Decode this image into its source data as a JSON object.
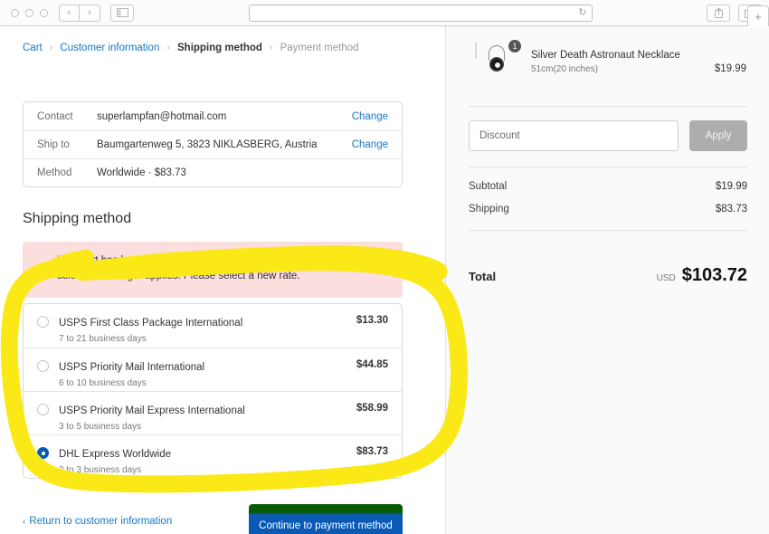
{
  "browser": {
    "traffic_lights": [
      "close-light",
      "minimize-light",
      "maximize-light"
    ],
    "back_glyph": "‹",
    "forward_glyph": "›",
    "sidebar_icon": "sidebar-toggle-icon",
    "url_value": "",
    "reload_glyph": "↻",
    "share_icon": "share-icon",
    "tabs_icon": "tab-overview-icon",
    "newtab_glyph": "+"
  },
  "breadcrumb": {
    "cart": "Cart",
    "customer_information": "Customer information",
    "shipping_method": "Shipping method",
    "payment_method": "Payment method",
    "separator": "›"
  },
  "summary": {
    "rows": [
      {
        "label": "Contact",
        "value": "superlampfan@hotmail.com",
        "action": "Change"
      },
      {
        "label": "Ship to",
        "value": "Baumgartenweg 5, 3823 NIKLASBERG, Austria",
        "action": "Change"
      },
      {
        "label": "Method",
        "value": "Worldwide · $83.73",
        "action": ""
      }
    ]
  },
  "shipping": {
    "heading": "Shipping method",
    "alert": "Your cart has been modified and the shipping rate you previously selected no longer applies. Please select a new rate.",
    "alert_bg": "#fbdede",
    "options": [
      {
        "name": "USPS First Class Package International",
        "days": "7 to 21 business days",
        "price": "$13.30",
        "selected": false
      },
      {
        "name": "USPS Priority Mail International",
        "days": "6 to 10 business days",
        "price": "$44.85",
        "selected": false
      },
      {
        "name": "USPS Priority Mail Express International",
        "days": "3 to 5 business days",
        "price": "$58.99",
        "selected": false
      },
      {
        "name": "DHL Express Worldwide",
        "days": "2 to 3 business days",
        "price": "$83.73",
        "selected": true
      }
    ]
  },
  "footer": {
    "back_chevron": "‹",
    "back_label": "Return to customer information",
    "continue_label": "Continue to payment method",
    "continue_color": "#0a5ab5"
  },
  "order": {
    "product": {
      "name": "Silver Death Astronaut Necklace",
      "variant": "51cm(20 inches)",
      "price": "$19.99",
      "quantity": "1",
      "image": "necklace-thumbnail"
    },
    "discount": {
      "placeholder": "Discount",
      "value": "",
      "apply_label": "Apply"
    },
    "totals": [
      {
        "label": "Subtotal",
        "value": "$19.99"
      },
      {
        "label": "Shipping",
        "value": "$83.73"
      }
    ],
    "grand_total": {
      "label": "Total",
      "currency": "USD",
      "value": "$103.72"
    }
  },
  "annotation": {
    "type": "highlighter-circle",
    "color": "#fbe817",
    "target": "shipping-options-list"
  }
}
